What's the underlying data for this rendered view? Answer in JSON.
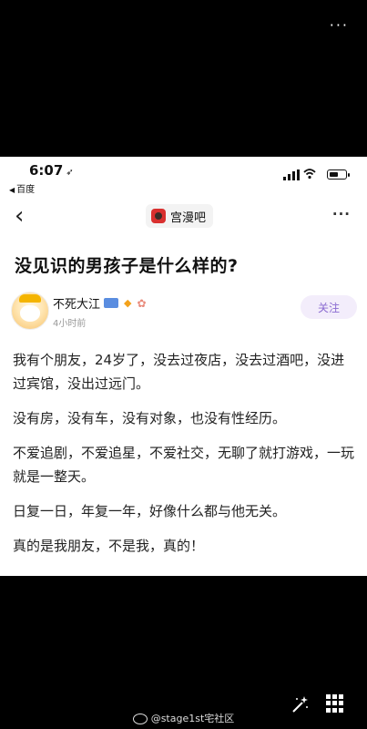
{
  "top_more": "···",
  "status": {
    "time": "6:07",
    "time_arrow": "➶",
    "back_app": "百度",
    "back_app_tri": "◀"
  },
  "nav": {
    "back": "‹",
    "forum_name": "宫漫吧",
    "more": "···"
  },
  "post": {
    "title": "没见识的男孩子是什么样的?",
    "author": "不死大江",
    "time": "4小时前",
    "follow_label": "关注",
    "paragraphs": [
      "我有个朋友，24岁了，没去过夜店，没去过酒吧，没进过宾馆，没出过远门。",
      "没有房，没有车，没有对象，也没有性经历。",
      "不爱追剧，不爱追星，不爱社交，无聊了就打游戏，一玩就是一整天。",
      "日复一日，年复一年，好像什么都与他无关。",
      "真的是我朋友，不是我，真的！"
    ]
  },
  "watermark": "@stage1st宅社区",
  "icons": {
    "wifi": "wifi-icon",
    "battery": "battery-icon",
    "signal": "signal-icon",
    "magic": "magic-wand-icon",
    "grid": "grid-icon",
    "gem": "gem-icon",
    "hands": "hands-icon"
  },
  "colors": {
    "follow_text": "#8b6bd1",
    "follow_bg": "#f3edfb",
    "forum_icon": "#d9302f"
  }
}
